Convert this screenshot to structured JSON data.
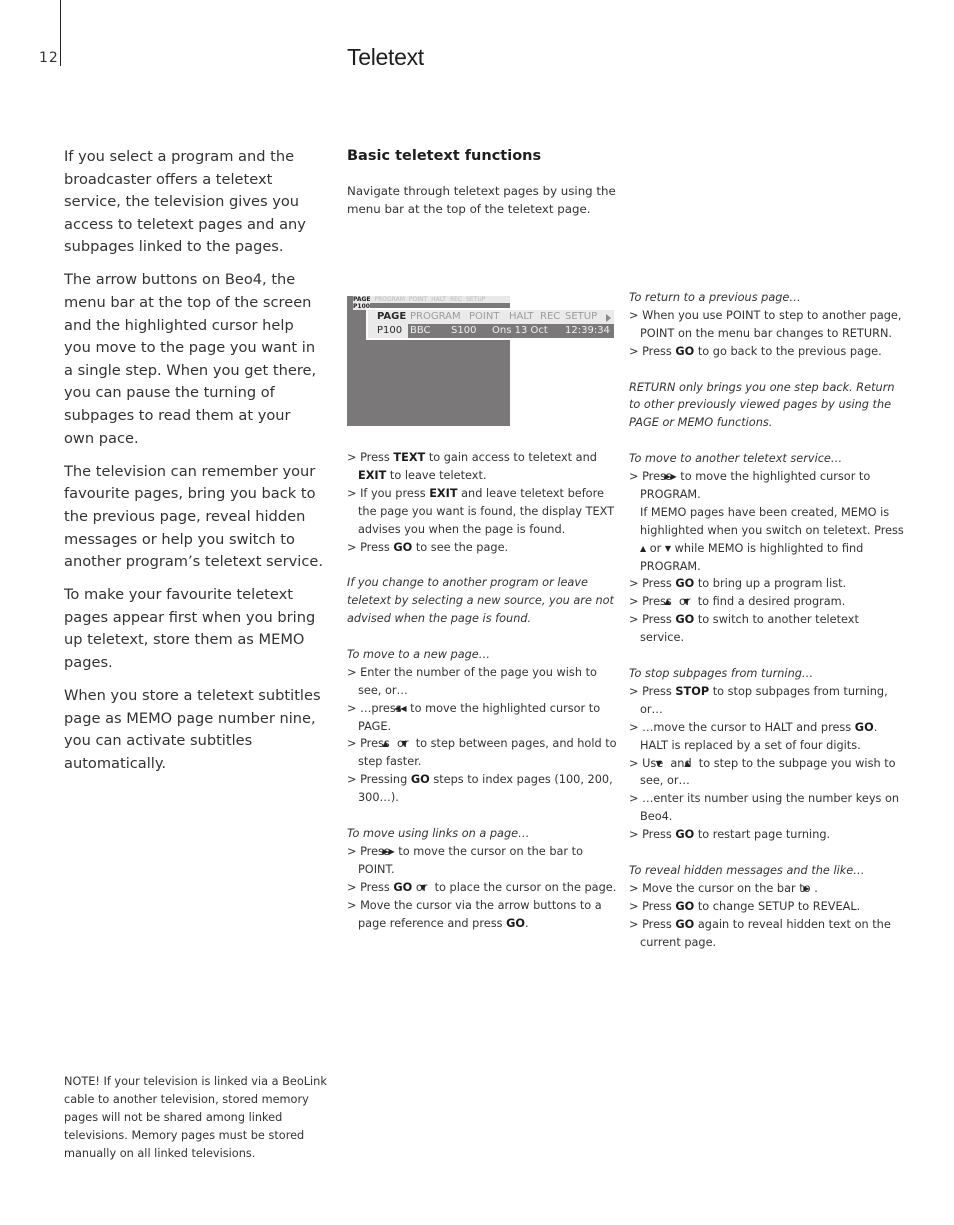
{
  "header": {
    "page_number": "12",
    "title": "Teletext"
  },
  "intro": {
    "paragraphs": [
      "If you select a program and the broadcaster offers a teletext service, the television gives you access to teletext pages and any subpages linked to the pages.",
      "The arrow buttons on Beo4, the menu bar at the top of the screen and the highlighted cursor help you move to the page you want in a single step. When you get there, you can pause the turning of subpages to read them at your own pace.",
      "The television can remember your favourite pages, bring you back to the previous page, reveal hidden messages or help you switch to another program’s teletext service.",
      "To make your favourite teletext pages appear first when you bring up teletext, store them as MEMO pages.",
      "When you store a teletext subtitles page as MEMO page number nine, you can activate subtitles automatically."
    ]
  },
  "section": {
    "title": "Basic teletext functions",
    "description": "Navigate through teletext pages by using the menu bar at the top of the teletext page."
  },
  "tv_menu": {
    "row1": [
      "PAGE",
      "PROGRAM",
      "POINT",
      "HALT",
      "REC",
      "SETUP"
    ],
    "row2": [
      "P100",
      "BBC",
      "S100",
      "Ons 13 Oct",
      "12:39:34"
    ],
    "arrow_icon": "triangle-right-icon",
    "colors": {
      "screen": "#7a7878",
      "bar": "#eaeaea",
      "border": "#ffffff"
    }
  },
  "col_a": {
    "basic_steps": [
      {
        "pre": "Press ",
        "key": "TEXT",
        "mid": " to gain access to teletext and ",
        "key2": "EXIT",
        "post": " to leave teletext."
      },
      {
        "pre": "If you press ",
        "key": "EXIT",
        "post": " and leave teletext before the page you want is found, the display TEXT advises you when the page is found."
      },
      {
        "pre": "Press ",
        "key": "GO",
        "post": " to see the page."
      }
    ],
    "note": "If you change to another program or leave teletext by selecting a new source, you are not advised when the page is found.",
    "new_page": {
      "heading": "To move to a new page…",
      "steps": [
        "Enter the number of the page you wish to see, or…",
        {
          "pre": "…press ",
          "icon": "rewind-icon",
          "post": " to move the highlighted cursor to PAGE."
        },
        {
          "pre": "Press ",
          "icon": "up-icon",
          "mid": " or ",
          "icon2": "down-icon",
          "post": " to step between pages, and hold to step faster."
        },
        {
          "pre": "Pressing ",
          "key": "GO",
          "post": " steps to index pages (100, 200, 300…)."
        }
      ]
    },
    "links": {
      "heading": "To move using links on a page…",
      "steps": [
        {
          "pre": "Press ",
          "icon": "fast-forward-icon",
          "post": " to move the cursor on the bar to POINT."
        },
        {
          "pre": "Press ",
          "key": "GO",
          "mid": " or ",
          "icon": "down-icon",
          "post": " to place the cursor on the page."
        },
        {
          "pre": "Move the cursor via the arrow buttons to a page reference and press ",
          "key": "GO",
          "post": "."
        }
      ]
    }
  },
  "col_b": {
    "return": {
      "heading": "To return to a previous page…",
      "steps": [
        "When you use POINT to step to another page, POINT on the menu bar changes to RETURN.",
        {
          "pre": "Press ",
          "key": "GO",
          "post": " to go back to the previous page."
        }
      ],
      "note": "RETURN only brings you one step back. Return to other previously viewed pages by using the PAGE or MEMO functions."
    },
    "service": {
      "heading": "To move to another teletext service…",
      "step1": {
        "pre": "Press ",
        "icon": "fast-forward-icon",
        "post": " to move the highlighted cursor to PROGRAM."
      },
      "memo_note": {
        "pre": "If MEMO pages have been created, MEMO is highlighted when you switch on teletext. Press ",
        "icon": "up-icon",
        "mid": " or ",
        "icon2": "down-icon",
        "post": " while MEMO is highlighted to find PROGRAM."
      },
      "steps": [
        {
          "pre": "Press ",
          "key": "GO",
          "post": " to bring up a program list."
        },
        {
          "pre": "Press ",
          "icon": "up-icon",
          "mid": " or ",
          "icon2": "down-icon",
          "post": " to find a desired program."
        },
        {
          "pre": "Press ",
          "key": "GO",
          "post": " to switch to another teletext service."
        }
      ]
    },
    "stop": {
      "heading": "To stop subpages from turning…",
      "steps": [
        {
          "pre": "Press ",
          "key": "STOP",
          "post": " to stop subpages from turning, or…"
        },
        {
          "pre": "…move the cursor to HALT and press ",
          "key": "GO",
          "post": ". HALT is replaced by a set of four digits."
        },
        {
          "pre": "Use ",
          "icon": "down-icon",
          "mid": " and ",
          "icon2": "up-icon",
          "post": " to step to the subpage you wish to see, or…"
        },
        "…enter its number using the number keys on Beo4.",
        {
          "pre": "Press ",
          "key": "GO",
          "post": " to restart page turning."
        }
      ]
    },
    "reveal": {
      "heading": "To reveal hidden messages and the like…",
      "steps": [
        {
          "pre": "Move the cursor on the bar to ",
          "icon": "right-icon",
          "post": "."
        },
        {
          "pre": "Press ",
          "key": "GO",
          "post": " to change SETUP to REVEAL."
        },
        {
          "pre": "Press ",
          "key": "GO",
          "post": " again to reveal hidden text on the current page."
        }
      ]
    }
  },
  "footer_note": "NOTE! If your television is linked via a BeoLink cable to another television, stored memory pages will not be shared among linked televisions. Memory pages must be stored manually on all linked televisions."
}
